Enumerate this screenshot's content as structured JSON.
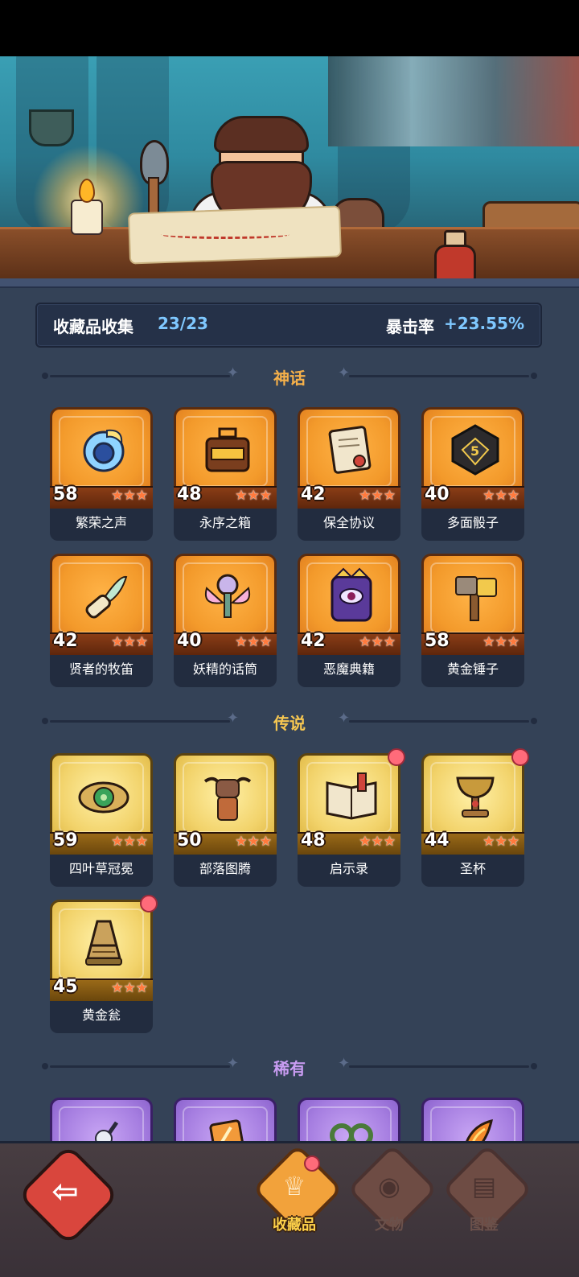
{
  "summary": {
    "label": "收藏品收集",
    "count": "23/23",
    "crit_label": "暴击率",
    "crit_value": "+23.55%"
  },
  "sections": {
    "myth": {
      "title": "神话",
      "color": "#f5b04a"
    },
    "legend": {
      "title": "传说",
      "color": "#f5c651"
    },
    "rare": {
      "title": "稀有",
      "color": "#c99cf2"
    }
  },
  "myth_items": [
    {
      "level": "58",
      "name": "繁荣之声",
      "icon": "spirit-orb-icon"
    },
    {
      "level": "48",
      "name": "永序之箱",
      "icon": "gold-chest-icon"
    },
    {
      "level": "42",
      "name": "保全协议",
      "icon": "contract-scroll-icon"
    },
    {
      "level": "40",
      "name": "多面骰子",
      "icon": "dice-icon"
    },
    {
      "level": "42",
      "name": "贤者的牧笛",
      "icon": "flute-icon"
    },
    {
      "level": "40",
      "name": "妖精的话筒",
      "icon": "fairy-microphone-icon"
    },
    {
      "level": "42",
      "name": "恶魔典籍",
      "icon": "demon-book-icon"
    },
    {
      "level": "58",
      "name": "黄金锤子",
      "icon": "golden-hammer-icon"
    }
  ],
  "legend_items": [
    {
      "level": "59",
      "name": "四叶草冠冕",
      "icon": "clover-crown-icon",
      "badge": false
    },
    {
      "level": "50",
      "name": "部落图腾",
      "icon": "tribal-totem-icon",
      "badge": false
    },
    {
      "level": "48",
      "name": "启示录",
      "icon": "revelation-book-icon",
      "badge": true
    },
    {
      "level": "44",
      "name": "圣杯",
      "icon": "holy-grail-icon",
      "badge": true
    },
    {
      "level": "45",
      "name": "黄金瓮",
      "icon": "golden-urn-icon",
      "badge": true
    }
  ],
  "stars": "★★★",
  "nav": {
    "collection": "收藏品",
    "relics": "文物",
    "codex": "图鉴"
  }
}
